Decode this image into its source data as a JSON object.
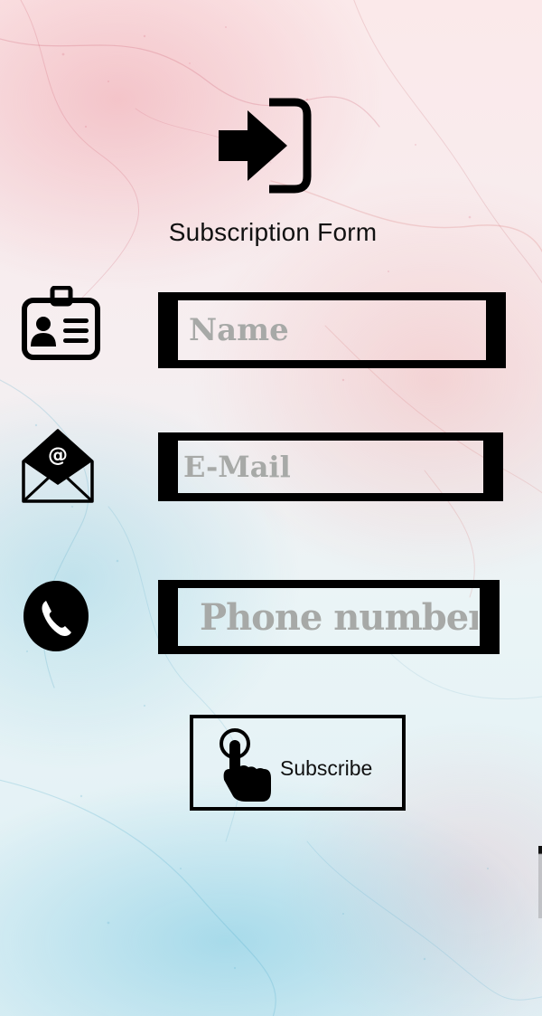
{
  "header": {
    "icon": "login-arrow-icon",
    "title": "Subscription Form"
  },
  "form": {
    "name": {
      "icon": "id-badge-icon",
      "placeholder": "Name",
      "value": ""
    },
    "email": {
      "icon": "envelope-at-icon",
      "placeholder": "E-Mail",
      "value": ""
    },
    "phone": {
      "icon": "phone-icon",
      "placeholder": "Phone number",
      "value": ""
    }
  },
  "subscribe": {
    "icon": "pointing-hand-icon",
    "label": "Subscribe"
  },
  "colors": {
    "ink": "#000000",
    "placeholder": "#a7a9a7",
    "background_pink": "#f3c9cd",
    "background_blue": "#bfe3ee"
  }
}
